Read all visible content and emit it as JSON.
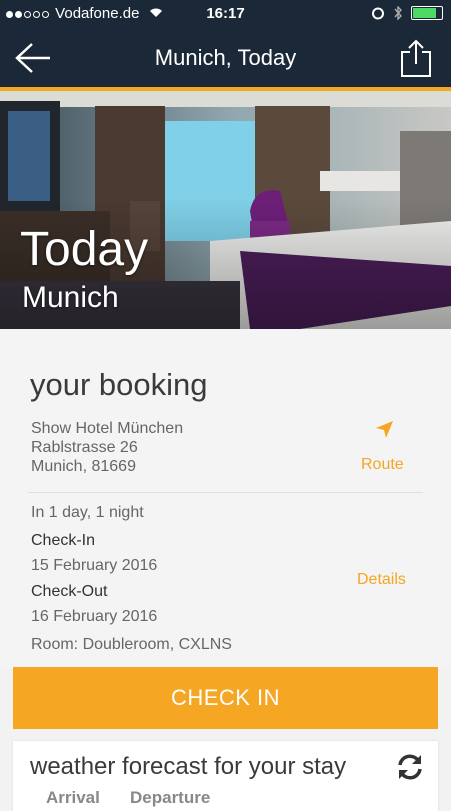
{
  "status_bar": {
    "carrier": "Vodafone.de",
    "time": "16:17",
    "battery_level": 0.9,
    "icons": [
      "signal-dots-icon",
      "wifi-icon",
      "alarm-icon",
      "bluetooth-icon",
      "battery-icon"
    ]
  },
  "navbar": {
    "title": "Munich, Today",
    "back_icon": "arrow-left-icon",
    "share_icon": "share-icon"
  },
  "hero": {
    "title": "Today",
    "subtitle": "Munich"
  },
  "booking": {
    "title": "your booking",
    "hotel_name": "Show Hotel München",
    "street": "Rablstrasse 26",
    "city": "Munich, 81669",
    "route_label": "Route",
    "stay_summary": "In 1 day, 1 night",
    "checkin_label": "Check-In",
    "checkin_date": "15 February 2016",
    "checkout_label": "Check-Out",
    "checkout_date": "16 February 2016",
    "room": "Room: Doubleroom, CXLNS",
    "details_label": "Details"
  },
  "checkin_button": "CHECK IN",
  "weather": {
    "title": "weather forecast for your stay",
    "tabs": [
      "Arrival",
      "Departure"
    ]
  },
  "colors": {
    "accent": "#f5a623",
    "navbar": "#1b2838",
    "background": "#f4f4f4"
  }
}
